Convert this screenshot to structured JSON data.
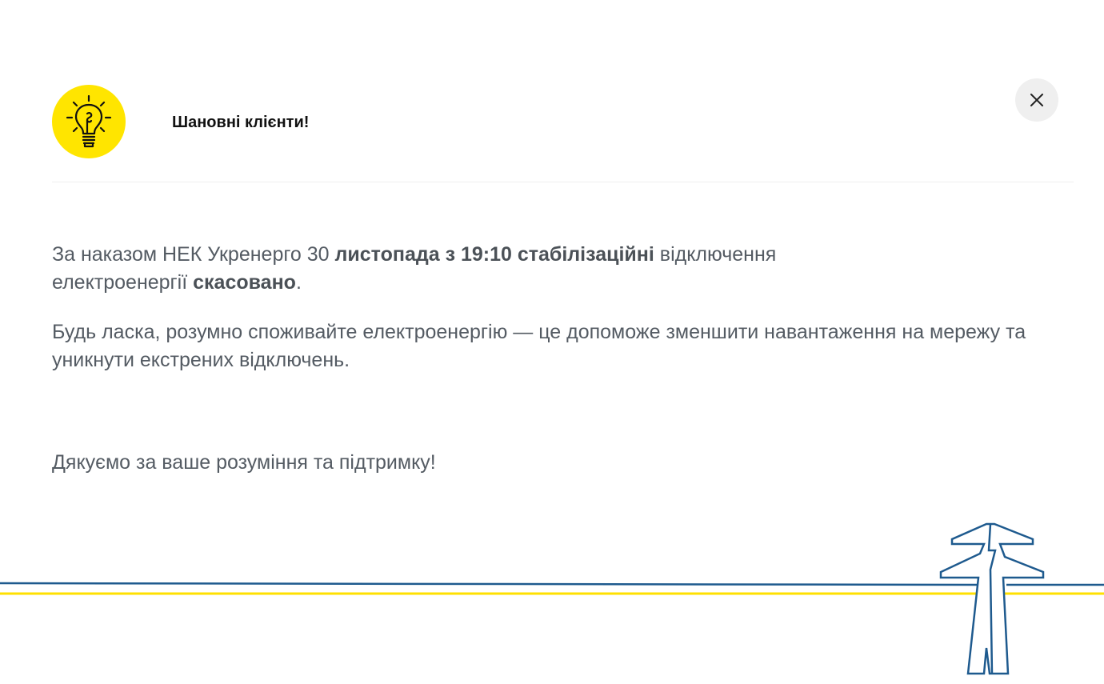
{
  "header": {
    "title": "Шановні клієнти!"
  },
  "message": {
    "p1": {
      "t1": "За наказом НЕК Укренерго 30 ",
      "b1": "листопада з 19:10 стабілізаційні",
      "t2": " відключення електроенергії ",
      "b2": "скасовано",
      "t3": "."
    },
    "p2": "Будь ласка, розумно споживайте електроенергію — це допоможе зменшити навантаження на мережу та уникнути екстрених відключень.",
    "p3": "Дякуємо за ваше розуміння та підтримку!"
  },
  "icons": {
    "logo": "lightbulb-icon",
    "close": "close-icon",
    "decoration": "power-tower-icon"
  },
  "colors": {
    "accent_yellow": "#ffe500",
    "line_blue": "#1e5a8e",
    "text_gray": "#545b63",
    "close_bg": "#efefef"
  }
}
